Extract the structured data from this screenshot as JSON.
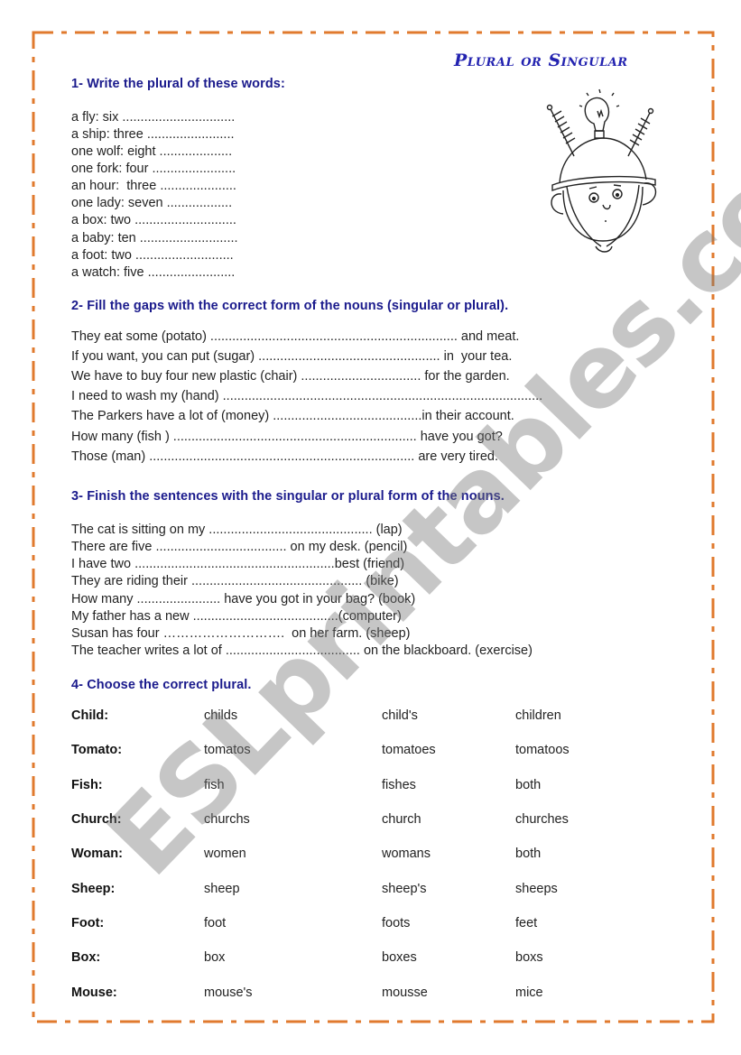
{
  "document": {
    "title": "Plural or Singular",
    "border_color": "#e07a2e",
    "heading_color": "#1a1a8c",
    "watermark": "ESLprintables.com"
  },
  "section1": {
    "heading": "1- Write the plural of these words:",
    "items": [
      "a fly: six ...............................",
      "a ship: three ........................",
      "one wolf: eight ....................",
      "one fork: four .......................",
      "an hour:  three .....................",
      "one lady: seven ..................",
      "a box: two ............................",
      "a baby: ten ...........................",
      "a foot: two ...........................",
      "a watch: five ........................"
    ]
  },
  "section2": {
    "heading": "2- Fill the gaps with the correct form of the nouns (singular or plural).",
    "items": [
      "They eat some (potato) .................................................................... and meat.",
      "If you want, you can put (sugar) .................................................. in  your tea.",
      "We have to buy four new plastic (chair) ................................. for the garden.",
      "I need to wash my (hand) ........................................................................................",
      "The Parkers have a lot of (money) .........................................in their account.",
      "How many (fish ) ................................................................... have you got?",
      "Those (man) ......................................................................... are very tired."
    ]
  },
  "section3": {
    "heading": "3- Finish the sentences with the singular or plural form of the nouns.",
    "items": [
      "The cat is sitting on my ............................................. (lap)",
      "There are five .................................... on my desk. (pencil)",
      "I have two .......................................................best (friend)",
      "They are riding their ............................................... (bike)",
      "How many ....................... have you got in your bag? (book)",
      "My father has a new ........................................(computer)",
      "Susan has four ……………………….  on her farm. (sheep)",
      "The teacher writes a lot of ..................................... on the blackboard. (exercise)"
    ]
  },
  "section4": {
    "heading": "4- Choose the correct plural.",
    "rows": [
      {
        "word": "Child:",
        "options": [
          "childs",
          "child's",
          "children"
        ]
      },
      {
        "word": "Tomato:",
        "options": [
          "tomatos",
          "tomatoes",
          "tomatoos"
        ]
      },
      {
        "word": "Fish:",
        "options": [
          "fish",
          "fishes",
          "both"
        ]
      },
      {
        "word": "Church:",
        "options": [
          "churchs",
          "church",
          "churches"
        ]
      },
      {
        "word": "Woman:",
        "options": [
          "women",
          "womans",
          "both"
        ]
      },
      {
        "word": "Sheep:",
        "options": [
          "sheep",
          "sheep's",
          "sheeps"
        ]
      },
      {
        "word": "Foot:",
        "options": [
          "foot",
          "foots",
          "feet"
        ]
      },
      {
        "word": "Box:",
        "options": [
          "box",
          "boxes",
          "boxs"
        ]
      },
      {
        "word": "Mouse:",
        "options": [
          "mouse's",
          "mousse",
          "mice"
        ]
      }
    ]
  }
}
